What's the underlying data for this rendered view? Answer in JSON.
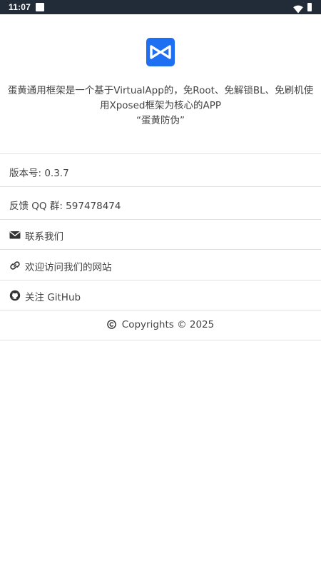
{
  "status_bar": {
    "time": "11:07",
    "icons": [
      "notification-square-icon",
      "wifi-icon",
      "battery-icon"
    ],
    "background": "#222b38"
  },
  "app": {
    "logo_icon": "bowtie-logo-icon",
    "logo_color": "#1e6ff1",
    "description_line1": "蛋黄通用框架是一个基于VirtualApp的，免Root、免解锁BL、免刷机使",
    "description_line2": "用Xposed框架为核心的APP",
    "description_line3": "“蛋黄防伪”"
  },
  "info": {
    "version": "版本号: 0.3.7",
    "feedback_qq": "反馈 QQ 群: 597478474"
  },
  "links": {
    "contact_icon": "envelope-icon",
    "contact_label": "联系我们",
    "website_icon": "link-icon",
    "website_label": "欢迎访问我们的网站",
    "github_icon": "github-icon",
    "github_label": "关注 GitHub"
  },
  "footer": {
    "copyright_icon": "copyright-icon",
    "copyright_text": "Copyrights © 2025"
  }
}
